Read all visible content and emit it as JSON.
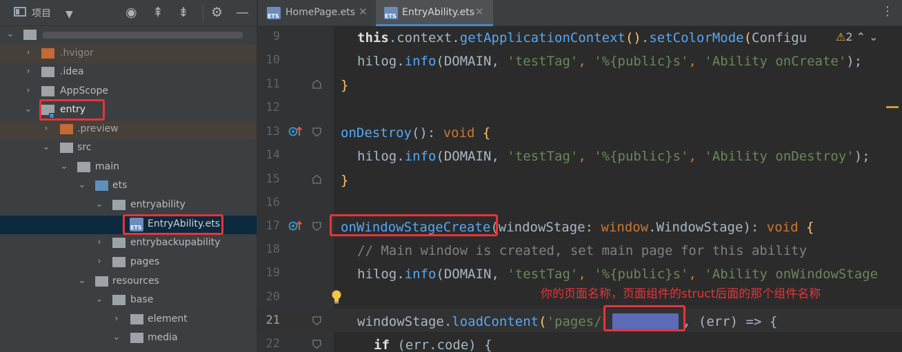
{
  "project_panel": {
    "title": "项目",
    "tree": [
      {
        "label": "",
        "blurred": true
      },
      {
        "label": ".hvigor"
      },
      {
        "label": ".idea"
      },
      {
        "label": "AppScope"
      },
      {
        "label": "entry"
      },
      {
        "label": ".preview"
      },
      {
        "label": "src"
      },
      {
        "label": "main"
      },
      {
        "label": "ets"
      },
      {
        "label": "entryability"
      },
      {
        "label": "EntryAbility.ets"
      },
      {
        "label": "entrybackupability"
      },
      {
        "label": "pages"
      },
      {
        "label": "resources"
      },
      {
        "label": "base"
      },
      {
        "label": "element"
      },
      {
        "label": "media"
      }
    ],
    "file_badge": "ETS"
  },
  "tabs": [
    {
      "label": "HomePage.ets",
      "active": false
    },
    {
      "label": "EntryAbility.ets",
      "active": true
    }
  ],
  "editor": {
    "line_numbers": [
      "9",
      "10",
      "11",
      "12",
      "13",
      "14",
      "15",
      "16",
      "17",
      "18",
      "19",
      "20",
      "21",
      "22"
    ],
    "current_line": "21",
    "warnings": {
      "glyph": "⚠",
      "count": "2"
    },
    "lines": {
      "l9": {
        "this": "this",
        "dot1": ".",
        "ctx": "context",
        "dot2": ".",
        "gac": "getApplicationContext",
        "par": "()",
        "dot3": ".",
        "scm": "setColorMode",
        "open": "(",
        "cfg": "Configu"
      },
      "l10": {
        "hilog": "hilog",
        "dot": ".",
        "info": "info",
        "open": "(DOMAIN, ",
        "s1": "'testTag'",
        "c1": ", ",
        "s2": "'%{public}s'",
        "c2": ", ",
        "s3": "'Ability onCreate'",
        "close": ");"
      },
      "l11": {
        "brace": "}"
      },
      "l13": {
        "name": "onDestroy",
        "sig": "(): ",
        "void": "void",
        "brace": " {"
      },
      "l14": {
        "hilog": "hilog",
        "dot": ".",
        "info": "info",
        "open": "(DOMAIN, ",
        "s1": "'testTag'",
        "c1": ", ",
        "s2": "'%{public}s'",
        "c2": ", ",
        "s3": "'Ability onDestroy'",
        "close": ");"
      },
      "l15": {
        "brace": "}"
      },
      "l17": {
        "name": "onWindowStageCreate",
        "open": "(windowStage: ",
        "ns": "window",
        "dot": ".",
        "type": "WindowStage",
        "sig": "): ",
        "void": "void",
        "brace": " {"
      },
      "l18": {
        "comment": "// Main window is created, set main page for this ability"
      },
      "l19": {
        "hilog": "hilog",
        "dot": ".",
        "info": "info",
        "open": "(DOMAIN, ",
        "s1": "'testTag'",
        "c1": ", ",
        "s2": "'%{public}s'",
        "c2": ", ",
        "s3": "'Ability onWindowStage"
      },
      "l21": {
        "ws": "windowStage",
        "dot": ".",
        "load": "loadContent",
        "open": "(",
        "str": "'pages/",
        "rest": ", (err) => {"
      },
      "l22": {
        "if": "if",
        "rest": " (err.code) {"
      }
    },
    "annotation": "你的页面名称，页面组件的struct后面的那个组件名称"
  },
  "colors": {
    "annotation_red": "#e8343a",
    "keyword": "#cc7832",
    "string": "#6a8759",
    "method": "#56a8f5",
    "function": "#ffc66d",
    "selection": "#0d293e"
  }
}
